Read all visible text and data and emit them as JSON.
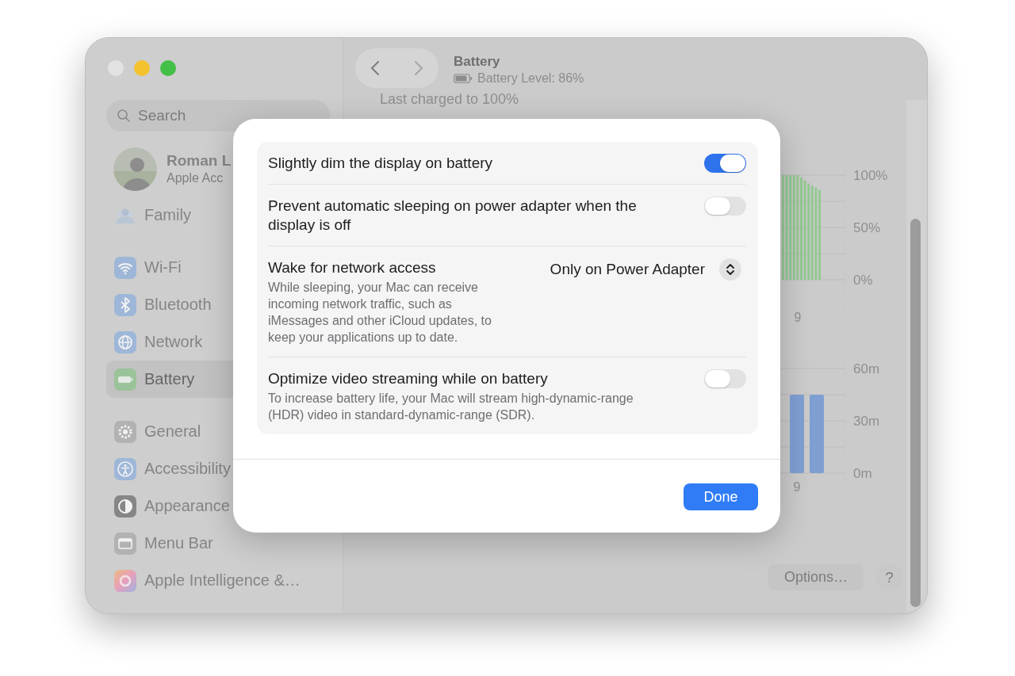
{
  "sidebar": {
    "search": {
      "placeholder": "Search"
    },
    "account": {
      "name": "Roman L",
      "subtitle": "Apple Acc"
    },
    "sections": [
      {
        "items": [
          {
            "label": "Family",
            "selected": false
          }
        ]
      },
      {
        "items": [
          {
            "label": "Wi-Fi",
            "selected": false
          },
          {
            "label": "Bluetooth",
            "selected": false
          },
          {
            "label": "Network",
            "selected": false
          },
          {
            "label": "Battery",
            "selected": true
          }
        ]
      },
      {
        "items": [
          {
            "label": "General",
            "selected": false
          },
          {
            "label": "Accessibility",
            "selected": false
          },
          {
            "label": "Appearance",
            "selected": false
          },
          {
            "label": "Menu Bar",
            "selected": false
          },
          {
            "label": "Apple Intelligence &…",
            "selected": false
          }
        ]
      }
    ]
  },
  "pane": {
    "title": "Battery",
    "battery_level": "Battery Level: 86%",
    "last_charged": "Last charged to 100%",
    "charts": [
      {
        "x_axis_label": "9",
        "chart_data": {
          "type": "bar",
          "ylim": [
            0,
            100
          ],
          "yticks": [
            {
              "value": 0,
              "label": "0%"
            },
            {
              "value": 50,
              "label": "50%"
            },
            {
              "value": 100,
              "label": "100%"
            }
          ],
          "series": [
            {
              "color": "#93c993",
              "values": [
                100,
                100,
                100,
                100,
                100,
                98,
                95,
                92,
                90,
                88,
                86
              ]
            }
          ]
        }
      },
      {
        "x_axis_label": "9",
        "chart_data": {
          "type": "bar",
          "ylim": [
            0,
            60
          ],
          "yticks": [
            {
              "value": 0,
              "label": "0m"
            },
            {
              "value": 30,
              "label": "30m"
            },
            {
              "value": 60,
              "label": "60m"
            }
          ],
          "series": [
            {
              "color": "#7f9fd3",
              "values": [
                45,
                45
              ]
            }
          ]
        }
      }
    ],
    "options_button": "Options…",
    "help_button": "?"
  },
  "sheet": {
    "rows": [
      {
        "kind": "toggle",
        "title": "Slightly dim the display on battery",
        "on": true
      },
      {
        "kind": "toggle",
        "title": "Prevent automatic sleeping on power adapter when the display is off",
        "on": false
      },
      {
        "kind": "popup",
        "title": "Wake for network access",
        "description": "While sleeping, your Mac can receive incoming network traffic, such as iMessages and other iCloud updates, to keep your applications up to date.",
        "value": "Only on Power Adapter"
      },
      {
        "kind": "toggle",
        "title": "Optimize video streaming while on battery",
        "description": "To increase battery life, your Mac will stream high-dynamic-range (HDR) video in standard-dynamic-range (SDR).",
        "on": false
      }
    ],
    "done_button": "Done"
  }
}
